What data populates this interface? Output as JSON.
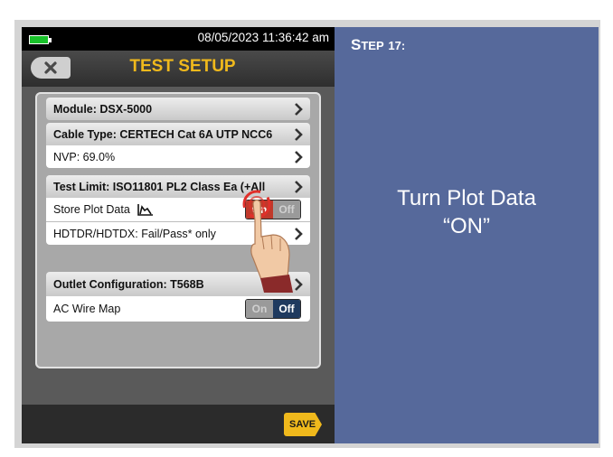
{
  "device": {
    "datetime": "08/05/2023 11:36:42 am",
    "title": "TEST SETUP",
    "battery_color": "#19c22a",
    "accent_color": "#f0b91c"
  },
  "settings": {
    "module": "Module: DSX-5000",
    "cable_type": "Cable Type: CERTECH Cat 6A UTP NCC6",
    "nvp": "NVP: 69.0%",
    "test_limit": "Test Limit: ISO11801 PL2 Class Ea (+All",
    "store_plot_data": {
      "label": "Store Plot Data",
      "on_label": "On",
      "off_label": "Off",
      "state": "On"
    },
    "hdtdr": "HDTDR/HDTDX: Fail/Pass* only",
    "outlet_config": "Outlet Configuration: T568B",
    "ac_wire_map": {
      "label": "AC Wire Map",
      "on_label": "On",
      "off_label": "Off",
      "state": "Off"
    }
  },
  "footer": {
    "save_label": "SAVE"
  },
  "step": {
    "prefix_big": "S",
    "prefix_small": "TEP",
    "number": "17:"
  },
  "instruction": {
    "line1": "Turn Plot Data",
    "line2": "“ON”"
  },
  "icons": [
    "back-x-icon",
    "chevron-right-icon",
    "plot-data-icon",
    "pointing-hand-icon"
  ]
}
